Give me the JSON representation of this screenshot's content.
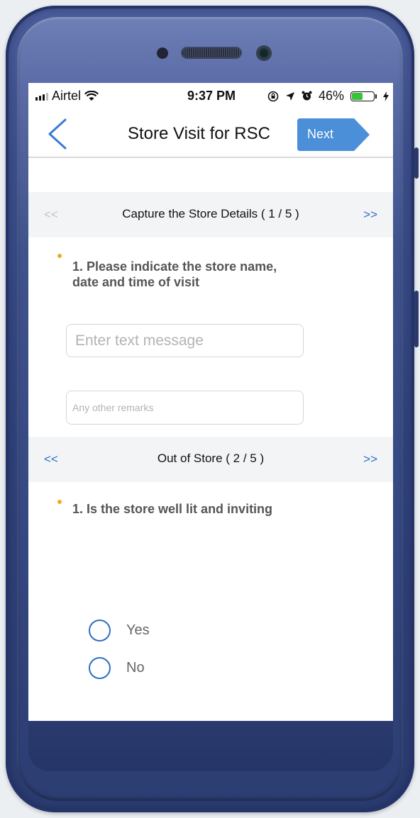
{
  "status": {
    "carrier": "Airtel",
    "time": "9:37 PM",
    "battery_percent": "46%",
    "battery_level": 0.46,
    "icons": [
      "signal-icon",
      "wifi-icon",
      "orientation-lock-icon",
      "location-icon",
      "alarm-icon",
      "battery-icon",
      "charging-icon"
    ]
  },
  "nav": {
    "title": "Store Visit for RSC",
    "next_label": "Next",
    "back_icon": "chevron-left-icon"
  },
  "colors": {
    "accent": "#4a8fd8",
    "link": "#2f6fc1",
    "bullet": "#f5a623",
    "section_bg": "#f2f4f6"
  },
  "sections": [
    {
      "prev": "<<",
      "title": "Capture the Store Details ( 1 / 5 )",
      "next": ">>",
      "question": "1. Please indicate the store name, date and time of visit",
      "inputs": [
        {
          "placeholder": "Enter text message",
          "value": ""
        },
        {
          "placeholder": "Any other remarks",
          "value": ""
        }
      ]
    },
    {
      "prev": "<<",
      "title": "Out of Store ( 2 / 5 )",
      "next": ">>",
      "question": "1. Is the store well lit and inviting",
      "options": [
        "Yes",
        "No"
      ]
    }
  ]
}
